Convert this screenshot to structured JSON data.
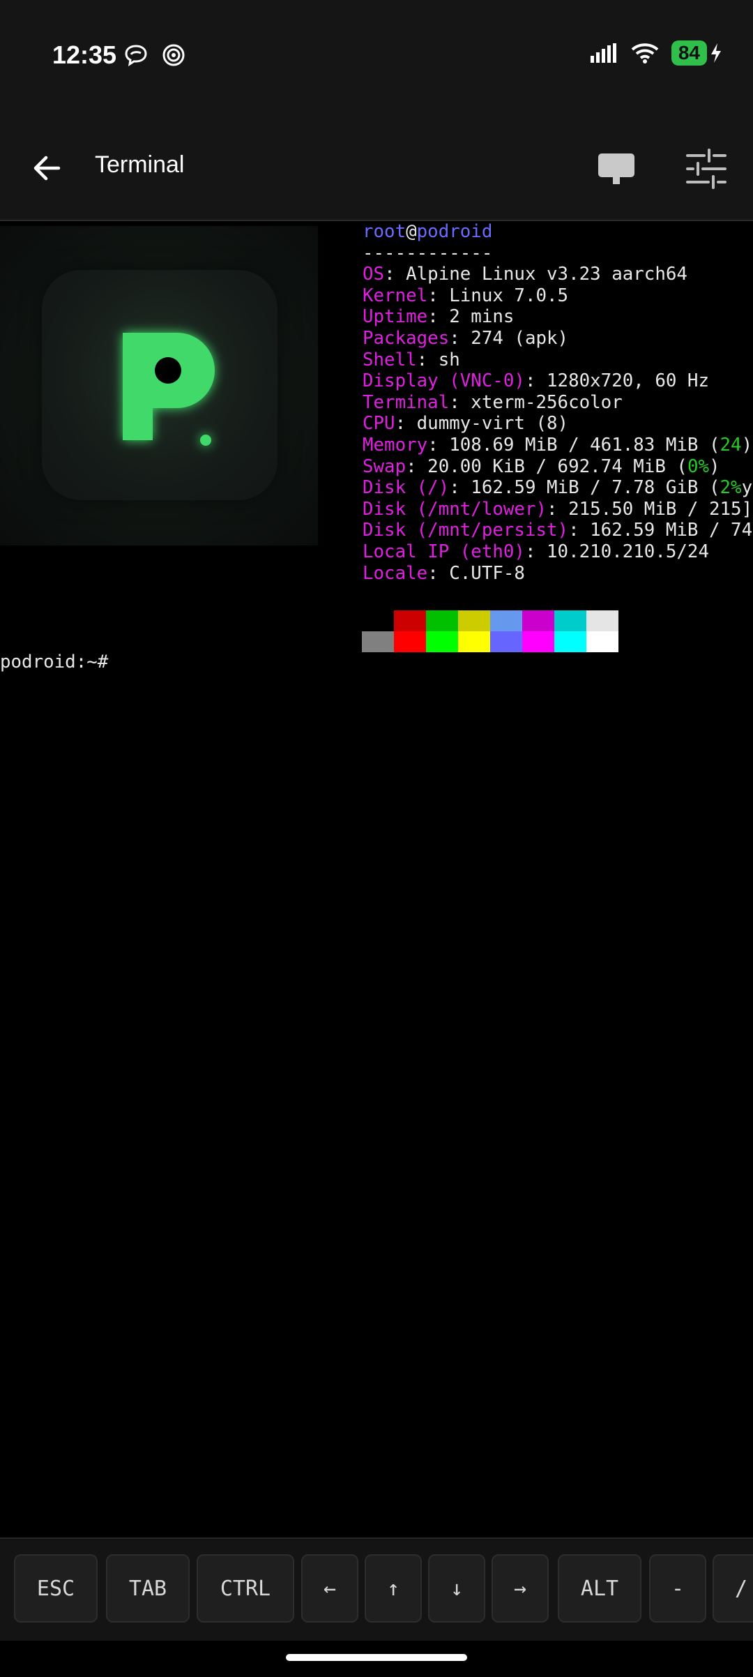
{
  "status": {
    "time": "12:35",
    "battery": "84"
  },
  "appbar": {
    "title": "Terminal"
  },
  "fetch": {
    "user": "root",
    "at": "@",
    "host": "podroid",
    "separator": "------------",
    "lines": [
      {
        "key": "OS",
        "value": ": Alpine Linux v3.23 aarch64"
      },
      {
        "key": "Kernel",
        "value": ": Linux 7.0.5"
      },
      {
        "key": "Uptime",
        "value": ": 2 mins"
      },
      {
        "key": "Packages",
        "value": ": 274 (apk)"
      },
      {
        "key": "Shell",
        "value": ": sh"
      },
      {
        "key": "Display (VNC-0)",
        "value": ": 1280x720, 60 Hz"
      },
      {
        "key": "Terminal",
        "value": ": xterm-256color"
      },
      {
        "key": "CPU",
        "value": ": dummy-virt (8)"
      },
      {
        "key": "Memory",
        "value": ": 108.69 MiB / 461.83 MiB (",
        "pct": "24",
        "tail": ")"
      },
      {
        "key": "Swap",
        "value": ": 20.00 KiB / 692.74 MiB (",
        "pct": "0%",
        "tail": ")"
      },
      {
        "key": "Disk (/)",
        "value": ": 162.59 MiB / 7.78 GiB (",
        "pct": "2%",
        "tail": "y"
      },
      {
        "key": "Disk (/mnt/lower)",
        "value": ": 215.50 MiB / 215]"
      },
      {
        "key": "Disk (/mnt/persist)",
        "value": ": 162.59 MiB / 74"
      },
      {
        "key": "Local IP (eth0)",
        "value": ": 10.210.210.5/24"
      },
      {
        "key": "Locale",
        "value": ": C.UTF-8"
      }
    ],
    "palette_top": [
      "#000000",
      "#cc0000",
      "#00c000",
      "#cccc00",
      "#6699ee",
      "#cc00cc",
      "#00cccc",
      "#e5e5e5"
    ],
    "palette_bottom": [
      "#808080",
      "#ff0000",
      "#00ff00",
      "#ffff00",
      "#6666ff",
      "#ff00ff",
      "#00ffff",
      "#ffffff"
    ]
  },
  "prompt": "podroid:~#",
  "keys": [
    {
      "label": "ESC",
      "name": "esc-key"
    },
    {
      "label": "TAB",
      "name": "tab-key"
    },
    {
      "label": "CTRL",
      "name": "ctrl-key"
    },
    {
      "label": "←",
      "name": "arrow-left-key"
    },
    {
      "label": "↑",
      "name": "arrow-up-key"
    },
    {
      "label": "↓",
      "name": "arrow-down-key"
    },
    {
      "label": "→",
      "name": "arrow-right-key"
    },
    {
      "label": "ALT",
      "name": "alt-key"
    },
    {
      "label": "-",
      "name": "dash-key"
    },
    {
      "label": "/",
      "name": "slash-key"
    }
  ],
  "colors": {
    "key_magenta": "#e020e0",
    "host_blue": "#6b6bff",
    "logo_green": "#3fd96b",
    "battery_green": "#2fbf4a"
  }
}
